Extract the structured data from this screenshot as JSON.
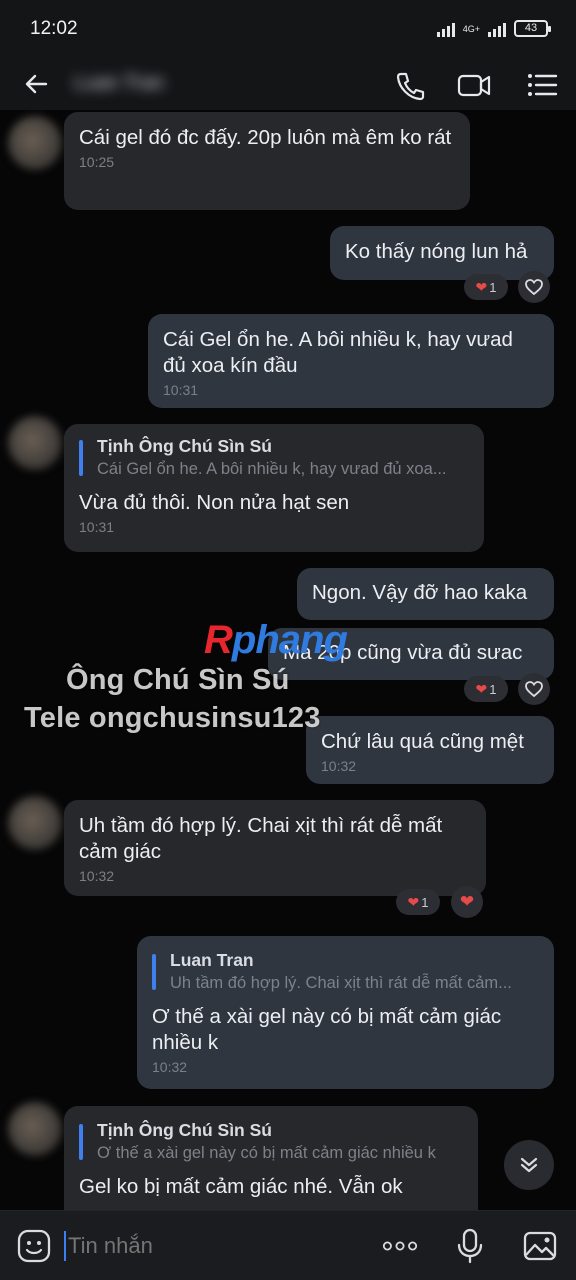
{
  "status_bar": {
    "time": "12:02",
    "network": "4G+",
    "battery": "43"
  },
  "header": {
    "contact_name": "Luan Tran"
  },
  "messages": [
    {
      "text": "Cái gel đó đc đấy. 20p luôn mà êm ko rát",
      "time": "10:25"
    },
    {
      "text": "Ko thấy nóng lun hả",
      "reaction_count": "1"
    },
    {
      "text": "Cái Gel ổn he. A bôi nhiều k, hay vưad đủ xoa kín đầu",
      "time": "10:31"
    },
    {
      "quote_name": "Tịnh Ông Chú Sìn Sú",
      "quote_text": "Cái Gel ổn he. A bôi nhiều k, hay vưad đủ xoa...",
      "text": "Vừa đủ thôi. Non nửa hạt sen",
      "time": "10:31"
    },
    {
      "text": "Ngon. Vậy đỡ hao kaka"
    },
    {
      "text": "Mà 20p cũng vừa đủ sưac",
      "reaction_count": "1"
    },
    {
      "text": "Chứ lâu quá cũng mệt",
      "time": "10:32"
    },
    {
      "text": "Uh tầm đó hợp lý. Chai xịt thì rát dễ mất cảm giác",
      "time": "10:32",
      "reaction_count": "1"
    },
    {
      "quote_name": "Luan Tran",
      "quote_text": "Uh tầm đó hợp lý. Chai xịt thì rát dễ mất cảm...",
      "text": "Ơ thế a xài gel này có bị mất cảm giác nhiều k",
      "time": "10:32"
    },
    {
      "quote_name": "Tịnh Ông Chú Sìn Sú",
      "quote_text": "Ơ thế a xài gel này có bị mất cảm giác nhiều k",
      "text": "Gel ko bị mất cảm giác nhé. Vẫn ok"
    }
  ],
  "watermark": {
    "logo_a": "R",
    "logo_b": "phang",
    "line1": "Ông Chú Sìn Sú",
    "line2": "Tele ongchusinsu123"
  },
  "composer": {
    "placeholder": "Tin nhắn"
  },
  "colors": {
    "accent": "#3f7ff0",
    "incoming_bubble": "#27282c",
    "outgoing_bubble": "#303640",
    "heart": "#e84a4a"
  },
  "icons": [
    "back-arrow-icon",
    "phone-icon",
    "video-camera-icon",
    "menu-icon",
    "heart-icon",
    "chevron-down-icon",
    "sticker-icon",
    "more-dots-icon",
    "microphone-icon",
    "image-icon"
  ]
}
